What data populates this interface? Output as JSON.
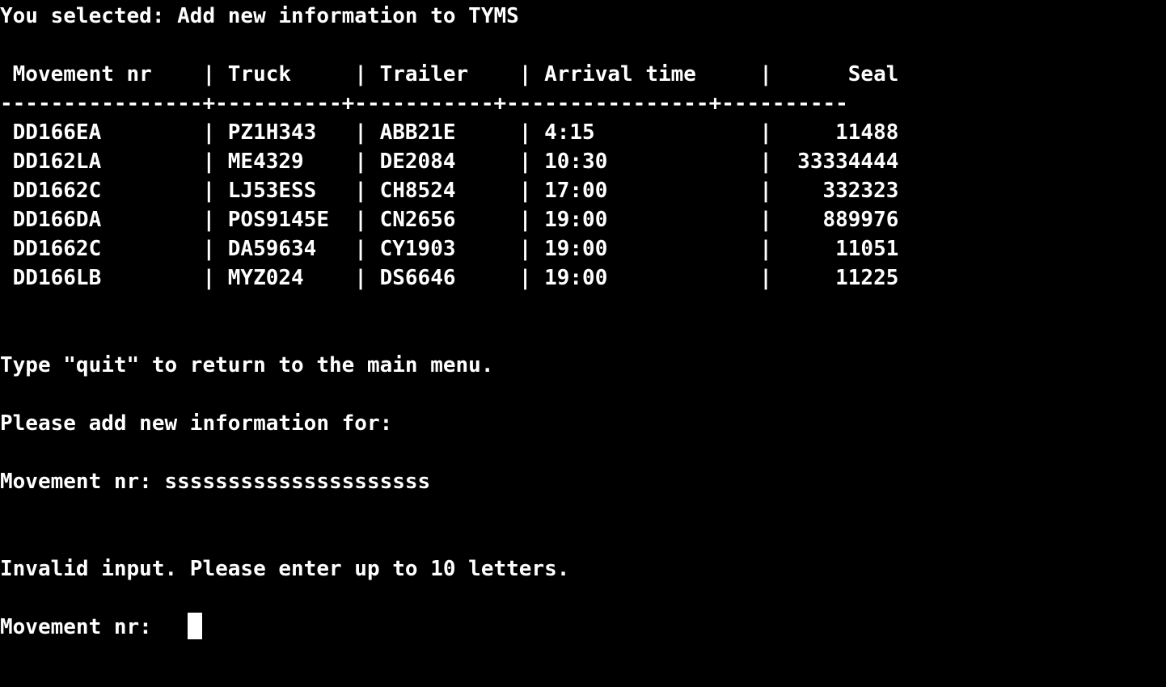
{
  "terminal": {
    "selected_line": "You selected: Add new information to TYMS",
    "table": {
      "header_line": " Movement nr    | Truck     | Trailer    | Arrival time     |      Seal",
      "separator_line": "----------------+----------+-----------+----------------+----------",
      "rows": [
        " DD166EA        | PZ1H343   | ABB21E     | 4:15             |     11488",
        " DD162LA        | ME4329    | DE2084     | 10:30            |  33334444",
        " DD1662C        | LJ53ESS   | CH8524     | 17:00            |    332323",
        " DD166DA        | POS9145E  | CN2656     | 19:00            |    889976",
        " DD1662C        | DA59634   | CY1903     | 19:00            |     11051",
        " DD166LB        | MYZ024    | DS6646     | 19:00            |     11225"
      ]
    },
    "quit_line": "Type \"quit\" to return to the main menu.",
    "add_info_line": "Please add new information for:",
    "first_entry_line": "Movement nr: sssssssssssssssssssss",
    "error_line": "Invalid input. Please enter up to 10 letters.",
    "prompt": "Movement nr: "
  },
  "colors": {
    "background": "#000000",
    "foreground": "#ffffff"
  }
}
